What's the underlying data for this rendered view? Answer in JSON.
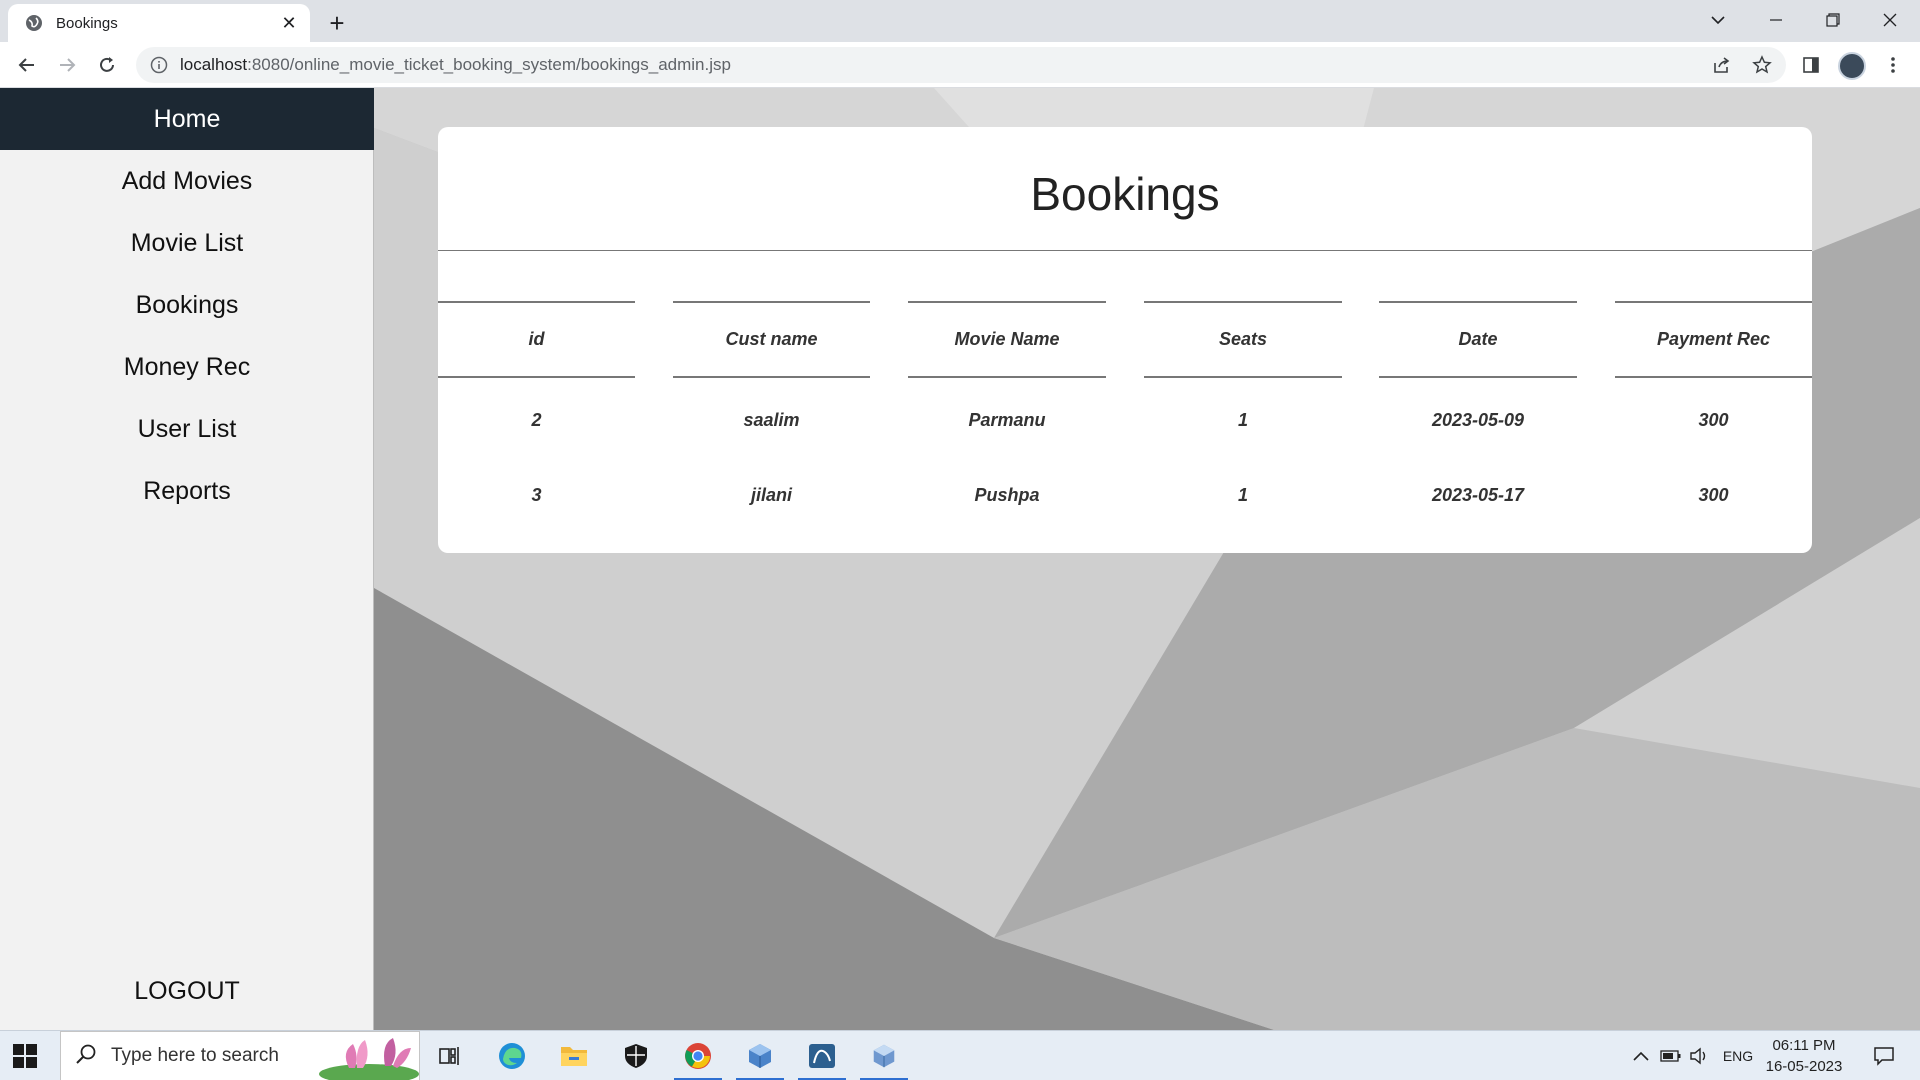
{
  "browser": {
    "tab_title": "Bookings",
    "url_host": "localhost",
    "url_rest": ":8080/online_movie_ticket_booking_system/bookings_admin.jsp"
  },
  "sidebar": {
    "items": [
      {
        "label": "Home"
      },
      {
        "label": "Add Movies"
      },
      {
        "label": "Movie List"
      },
      {
        "label": "Bookings"
      },
      {
        "label": "Money Rec"
      },
      {
        "label": "User List"
      },
      {
        "label": "Reports"
      }
    ],
    "logout": "LOGOUT"
  },
  "main": {
    "title": "Bookings",
    "columns": [
      "id",
      "Cust name",
      "Movie Name",
      "Seats",
      "Date",
      "Payment Rec"
    ],
    "rows": [
      [
        "2",
        "saalim",
        "Parmanu",
        "1",
        "2023-05-09",
        "300"
      ],
      [
        "3",
        "jilani",
        "Pushpa",
        "1",
        "2023-05-17",
        "300"
      ]
    ]
  },
  "taskbar": {
    "search_placeholder": "Type here to search",
    "language": "ENG",
    "time": "06:11 PM",
    "date": "16-05-2023"
  }
}
